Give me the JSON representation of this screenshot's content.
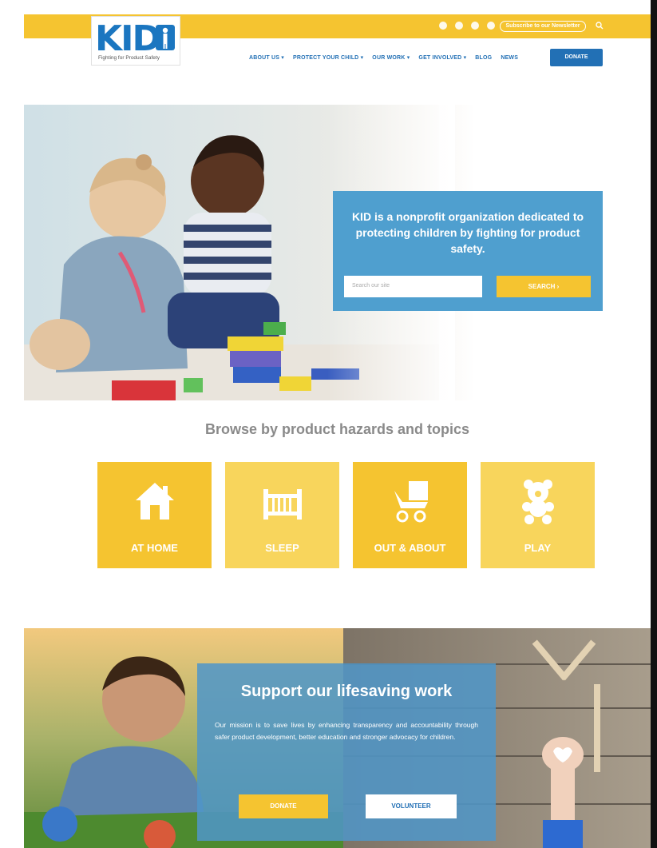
{
  "colors": {
    "yellow": "#f5c430",
    "light_yellow": "#f8d55c",
    "blue": "#2270b5",
    "light_blue": "#4f9fcf"
  },
  "logo": {
    "text": "KID",
    "tagline": "Fighting for Product Safety"
  },
  "topbar": {
    "social_icons": [
      "twitter-icon",
      "facebook-icon",
      "pinterest-icon",
      "instagram-icon"
    ],
    "newsletter_label": "Subscribe to our Newsletter",
    "search_icon": "search-icon"
  },
  "nav": {
    "items": [
      {
        "label": "ABOUT US ▾"
      },
      {
        "label": "PROTECT YOUR CHILD ▾"
      },
      {
        "label": "OUR WORK ▾"
      },
      {
        "label": "GET INVOLVED ▾"
      },
      {
        "label": "BLOG"
      },
      {
        "label": "NEWS"
      }
    ],
    "donate_label": "DONATE"
  },
  "hero": {
    "headline": "KID is a nonprofit organization dedicated to protecting children by fighting for product safety.",
    "search_placeholder": "Search our site",
    "search_button": "SEARCH ›"
  },
  "browse": {
    "title": "Browse by product hazards and topics",
    "tiles": [
      {
        "label": "AT HOME",
        "icon": "house-icon"
      },
      {
        "label": "SLEEP",
        "icon": "crib-icon"
      },
      {
        "label": "OUT & ABOUT",
        "icon": "stroller-icon"
      },
      {
        "label": "PLAY",
        "icon": "teddy-bear-icon"
      }
    ]
  },
  "support": {
    "heading": "Support our lifesaving work",
    "body": "Our mission is to save lives by enhancing transparency and accountability through safer product development, better education and stronger advocacy for children.",
    "donate_label": "DONATE",
    "volunteer_label": "VOLUNTEER"
  }
}
